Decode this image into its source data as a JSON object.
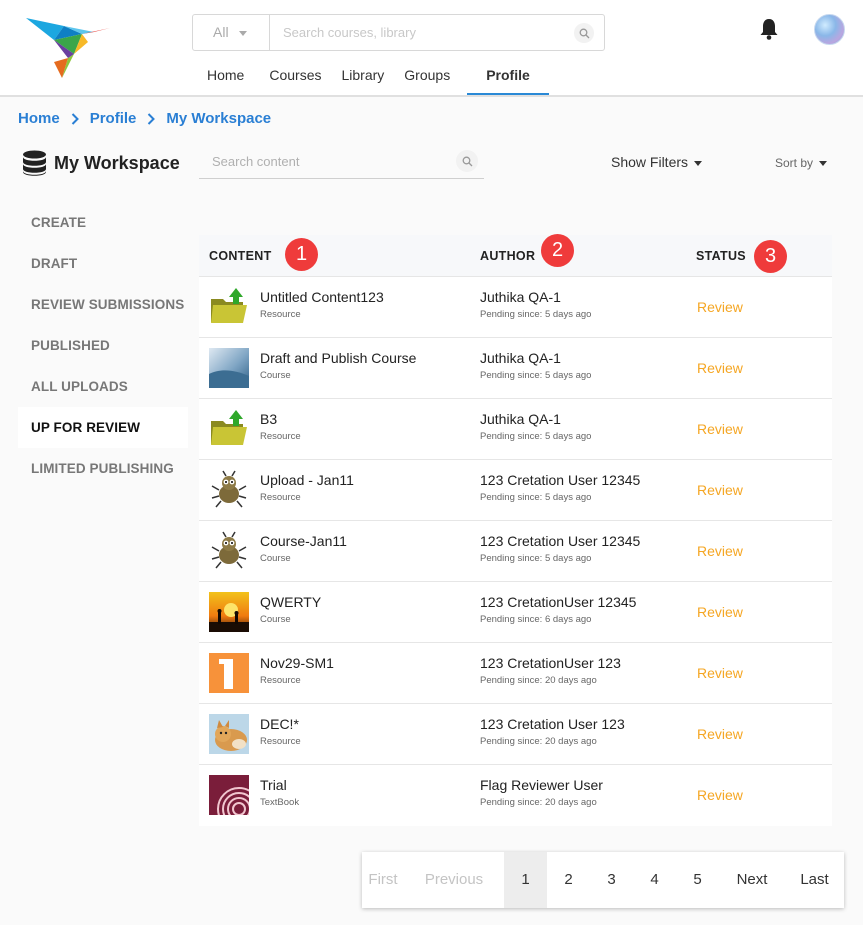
{
  "header": {
    "search": {
      "scope": "All",
      "placeholder": "Search courses, library"
    },
    "nav": [
      "Home",
      "Courses",
      "Library",
      "Groups",
      "Profile"
    ],
    "active_nav": "Profile"
  },
  "breadcrumb": [
    "Home",
    "Profile",
    "My Workspace"
  ],
  "workspace": {
    "title": "My Workspace",
    "search_placeholder": "Search content",
    "show_filters": "Show Filters",
    "sort_by": "Sort by"
  },
  "sidebar": {
    "items": [
      "CREATE",
      "DRAFT",
      "REVIEW SUBMISSIONS",
      "PUBLISHED",
      "ALL UPLOADS",
      "UP FOR REVIEW",
      "LIMITED PUBLISHING"
    ],
    "active": "UP FOR REVIEW"
  },
  "table": {
    "headers": {
      "content": "CONTENT",
      "author": "AUTHOR",
      "status": "STATUS"
    },
    "badges": {
      "content": "1",
      "author": "2",
      "status": "3"
    },
    "rows": [
      {
        "title": "Untitled Content123",
        "type": "Resource",
        "author": "Juthika QA-1",
        "pending": "Pending since: 5 days ago",
        "status": "Review",
        "thumb": "folder-upload"
      },
      {
        "title": "Draft and Publish Course",
        "type": "Course",
        "author": "Juthika QA-1",
        "pending": "Pending since: 5 days ago",
        "status": "Review",
        "thumb": "photo-blue"
      },
      {
        "title": "B3",
        "type": "Resource",
        "author": "Juthika QA-1",
        "pending": "Pending since: 5 days ago",
        "status": "Review",
        "thumb": "folder-upload"
      },
      {
        "title": "Upload - Jan11",
        "type": "Resource",
        "author": "123 Cretation User 12345",
        "pending": "Pending since: 5 days ago",
        "status": "Review",
        "thumb": "bug"
      },
      {
        "title": "Course-Jan11",
        "type": "Course",
        "author": "123 Cretation User 12345",
        "pending": "Pending since: 5 days ago",
        "status": "Review",
        "thumb": "bug"
      },
      {
        "title": "QWERTY",
        "type": "Course",
        "author": "123 CretationUser 12345",
        "pending": "Pending since: 6 days ago",
        "status": "Review",
        "thumb": "sunset"
      },
      {
        "title": "Nov29-SM1",
        "type": "Resource",
        "author": "123 CretationUser 123",
        "pending": "Pending since: 20 days ago",
        "status": "Review",
        "thumb": "number-one"
      },
      {
        "title": "DEC!*",
        "type": "Resource",
        "author": "123 Cretation User 123",
        "pending": "Pending since: 20 days ago",
        "status": "Review",
        "thumb": "cat"
      },
      {
        "title": "Trial",
        "type": "TextBook",
        "author": "Flag Reviewer User",
        "pending": "Pending since: 20 days ago",
        "status": "Review",
        "thumb": "onion"
      }
    ]
  },
  "pagination": [
    "First",
    "Previous",
    "1",
    "2",
    "3",
    "4",
    "5",
    "Next",
    "Last"
  ],
  "colors": {
    "accent": "#2a7fd4",
    "review": "#f5a623",
    "badge": "#ef3b3b"
  }
}
